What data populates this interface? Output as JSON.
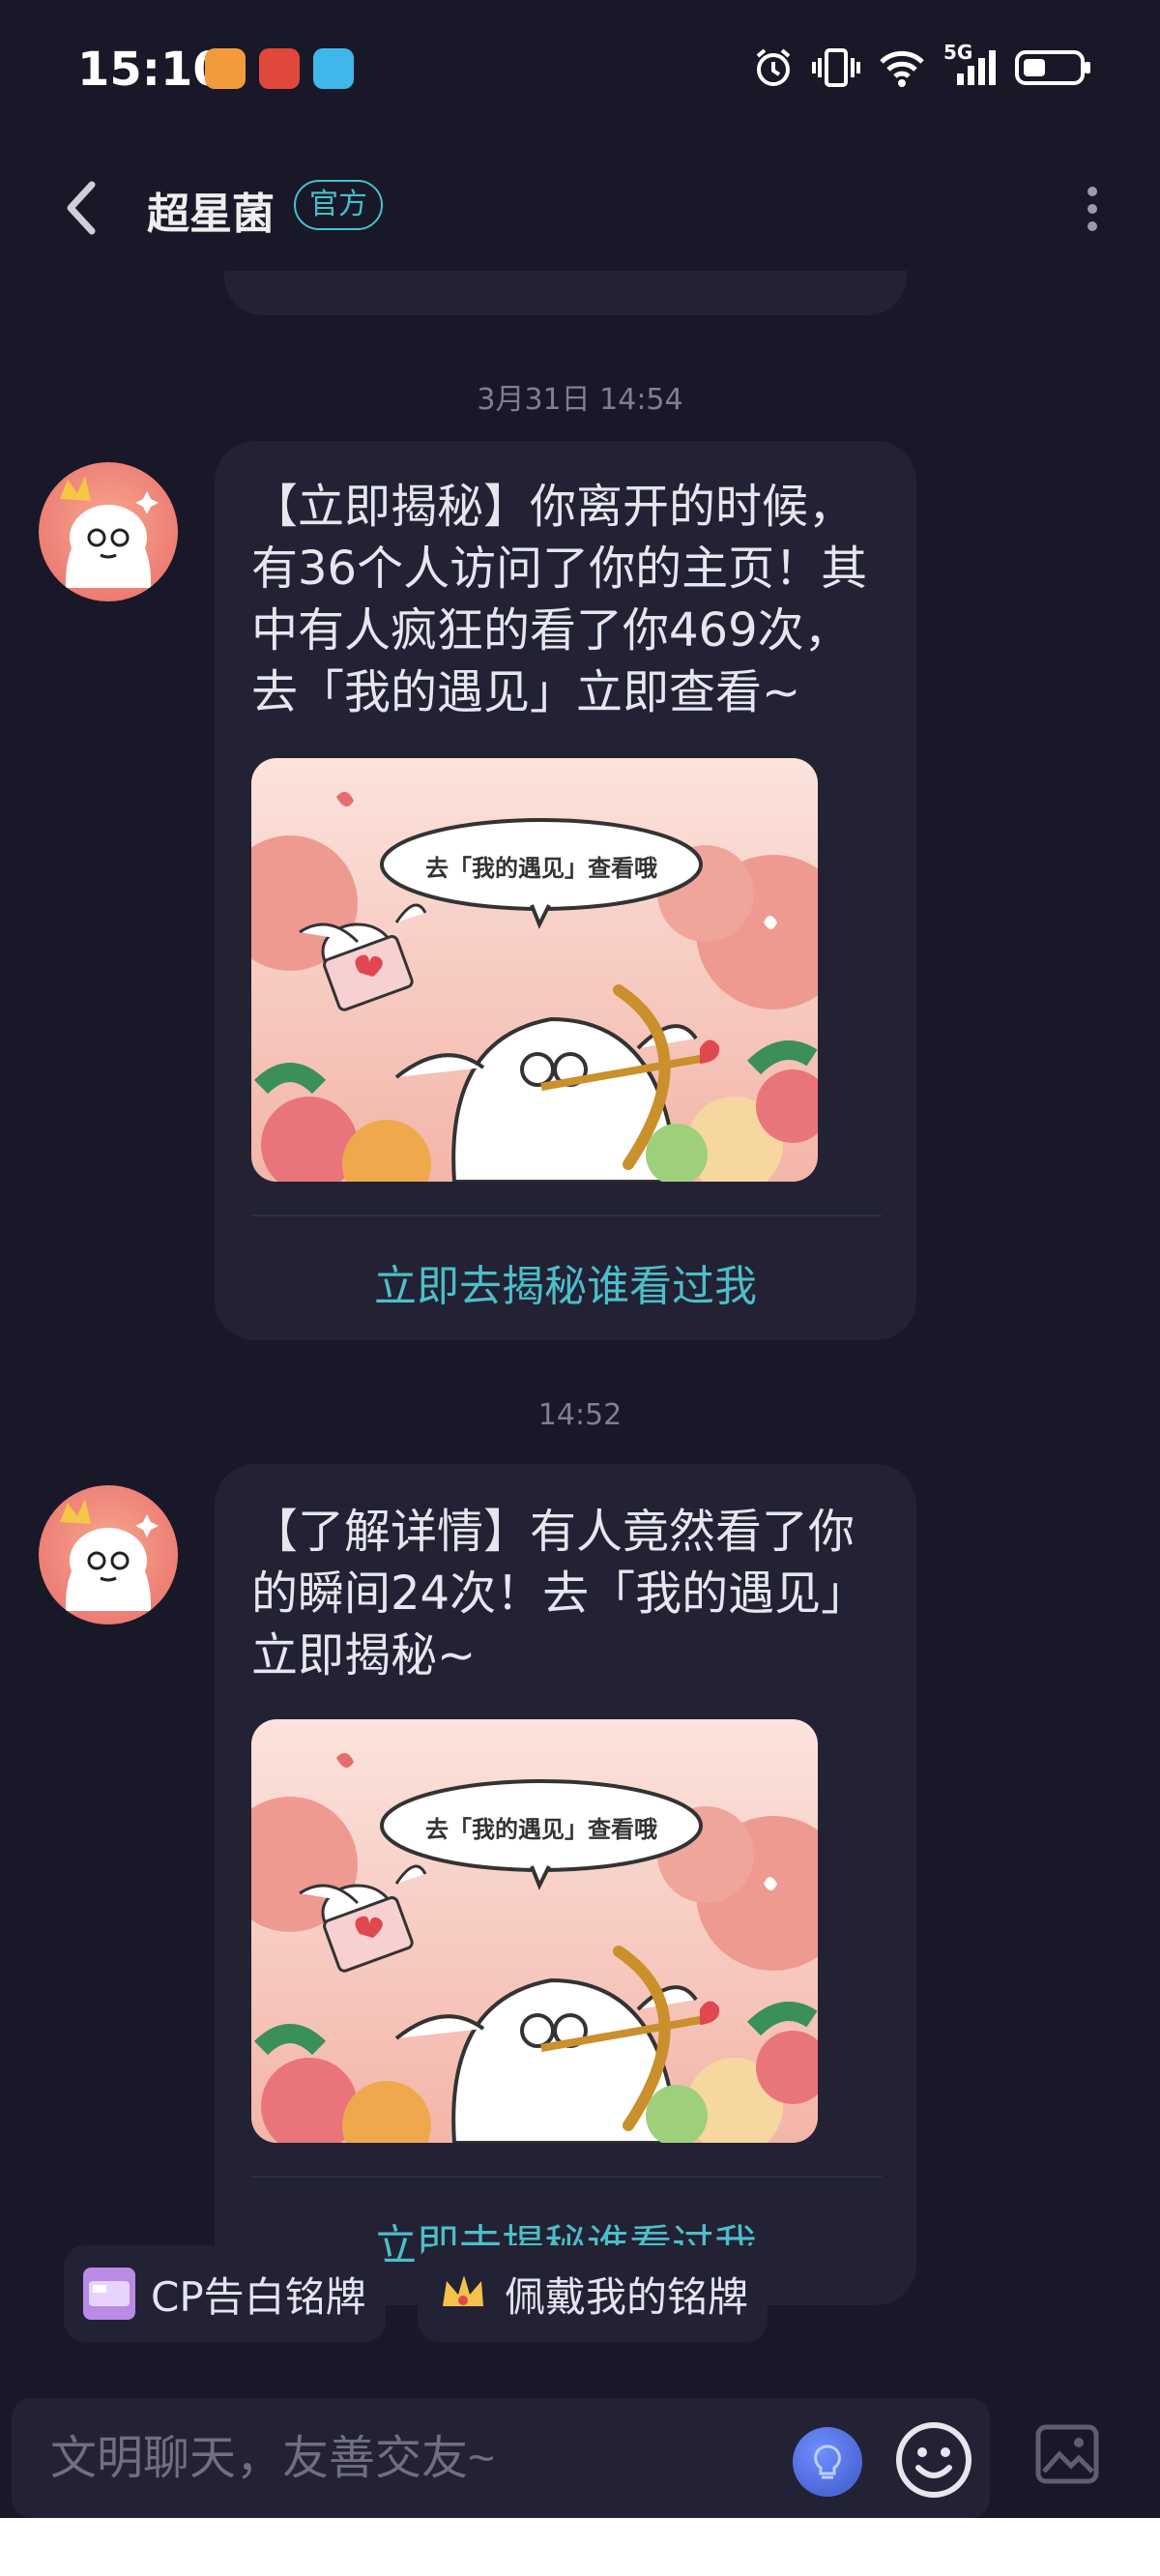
{
  "status_bar": {
    "time": "15:10",
    "network_label": "5G"
  },
  "header": {
    "title": "超星菌",
    "badge": "官方"
  },
  "messages": [
    {
      "timestamp": "3月31日 14:54",
      "text": "【立即揭秘】你离开的时候，有36个人访问了你的主页！其中有人疯狂的看了你469次，去「我的遇见」立即查看~",
      "image_caption": "去「我的遇见」查看哦",
      "link_label": "立即去揭秘谁看过我"
    },
    {
      "timestamp": "14:52",
      "text": "【了解详情】有人竟然看了你的瞬间24次！去「我的遇见」立即揭秘~",
      "image_caption": "去「我的遇见」查看哦",
      "link_label": "立即去揭秘谁看过我"
    }
  ],
  "quick_actions": [
    {
      "label": "CP告白铭牌",
      "icon": "cp-badge-icon"
    },
    {
      "label": "佩戴我的铭牌",
      "icon": "crown-badge-icon"
    }
  ],
  "input": {
    "placeholder": "文明聊天，友善交友~"
  },
  "colors": {
    "background": "#181828",
    "bubble": "#222234",
    "accent": "#45c1cc"
  }
}
